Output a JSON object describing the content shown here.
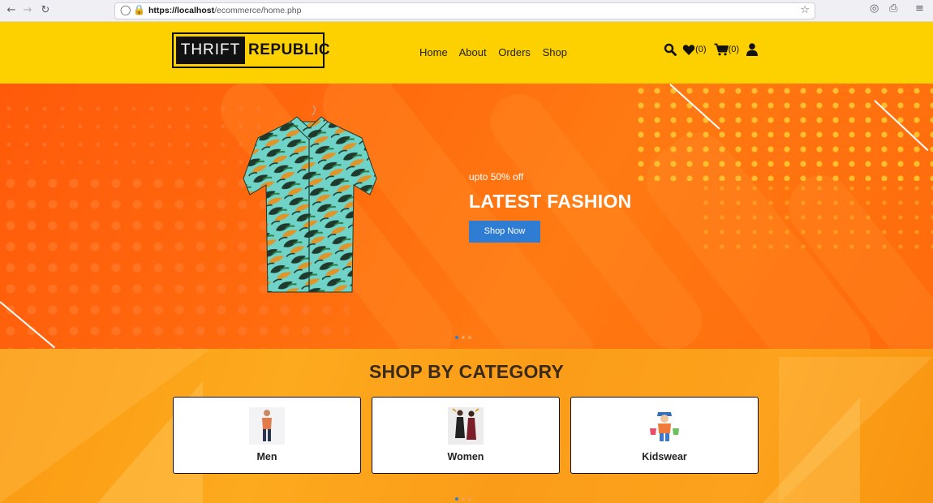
{
  "browser": {
    "url_host": "https://localhost",
    "url_path": "/ecommerce/home.php"
  },
  "header": {
    "logo_part1": "THRIFT",
    "logo_part2": "REPUBLIC",
    "menu": [
      "Home",
      "About",
      "Orders",
      "Shop"
    ],
    "wishlist_count": "(0)",
    "cart_count": "(0)",
    "bg_color": "#fdd000"
  },
  "hero": {
    "promo_text": "upto 50% off",
    "headline": "LATEST FASHION",
    "button_label": "Shop Now",
    "button_color": "#2f7dd3",
    "slides": 3,
    "active_slide": 1
  },
  "categories": {
    "title": "SHOP BY CATEGORY",
    "items": [
      {
        "label": "Men",
        "icon": "man-figure-icon"
      },
      {
        "label": "Women",
        "icon": "women-figures-icon"
      },
      {
        "label": "Kidswear",
        "icon": "kid-figure-icon"
      }
    ],
    "slides": 3,
    "active_slide": 1
  }
}
